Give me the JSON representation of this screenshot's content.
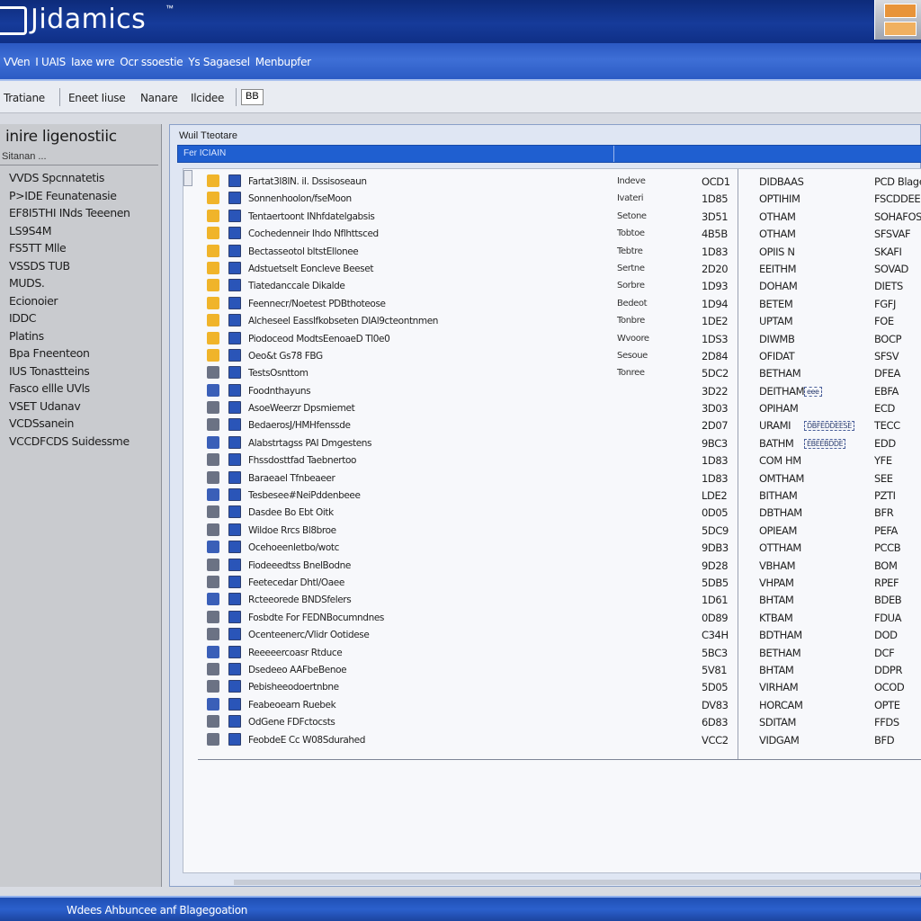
{
  "app": {
    "logo_text": "Jidamics",
    "trademark": "™"
  },
  "menu": [
    {
      "label": "VVen"
    },
    {
      "label": "I UAIS"
    },
    {
      "label": "Iaxe wre"
    },
    {
      "label": "Ocr ssoestie"
    },
    {
      "label": "Ys Sagaesel"
    },
    {
      "label": "Menbupfer"
    }
  ],
  "toolbar": {
    "items": [
      {
        "label": "Tratiane"
      },
      {
        "label": "Eneet Iiuse"
      },
      {
        "label": "Nanare"
      },
      {
        "label": "Ilcidee"
      }
    ],
    "box_label": "BB"
  },
  "left_pane": {
    "title": "inire ligenostiic",
    "subtitle": "Sitanan ...",
    "items": [
      "VVDS Spcnnatetis",
      "P>IDE Feunatenasie",
      "EF8I5THI INds Teeenen",
      "LS9S4M",
      "FS5TT Mlle",
      "VSSDS TUB",
      "MUDS.",
      "Ecionoier",
      "IDDC",
      "Platins",
      "Bpa Fneenteon",
      "IUS Tonastteins",
      "Fasco ellle UVls",
      "VSET Udanav",
      "VCDSsanein",
      "VCCDFCDS Suidessme"
    ]
  },
  "main": {
    "title": "Wuil Tteotare",
    "header_label": "Fer ICIAIN",
    "rows": [
      {
        "name": "Fartat3I8IN. iI. Dssisoseaun",
        "type": "Indeve",
        "code": "OCD1",
        "status": "DIDBAAS",
        "desc": "PCD Blagegoainen",
        "badge": ""
      },
      {
        "name": "Sonnenhoolon/fseMoon",
        "type": "Ivateri",
        "code": "1D85",
        "status": "OPTIHIM",
        "desc": "FSCDDEER",
        "badge": ""
      },
      {
        "name": "Tentaertoont INhfdatelgabsis",
        "type": "Setone",
        "code": "3D51",
        "status": "OTHAM",
        "desc": "SOHAFOS",
        "badge": ""
      },
      {
        "name": "Cochedenneir Ihdo Nflhttsced",
        "type": "Tobtoe",
        "code": "4B5B",
        "status": "OTHAM",
        "desc": "SFSVAF",
        "badge": ""
      },
      {
        "name": "Bectasseotol bltstEllonee",
        "type": "Tebtre",
        "code": "1D83",
        "status": "OPIIS N",
        "desc": "SKAFI",
        "badge": ""
      },
      {
        "name": "Adstuetselt Eoncleve Beeset",
        "type": "Sertne",
        "code": "2D20",
        "status": "EEITHM",
        "desc": "SOVAD",
        "badge": ""
      },
      {
        "name": "Tiatedanccale Dikalde",
        "type": "Sorbre",
        "code": "1D93",
        "status": "DOHAM",
        "desc": "DIETS",
        "badge": ""
      },
      {
        "name": "Feennecr/Noetest PDBthoteose",
        "type": "Bedeot",
        "code": "1D94",
        "status": "BETEM",
        "desc": "FGFJ",
        "badge": ""
      },
      {
        "name": "Alcheseel Easslfkobseten DIAl9cteontnmen",
        "type": "Tonbre",
        "code": "1DE2",
        "status": "UPTAM",
        "desc": "FOE",
        "badge": ""
      },
      {
        "name": "Piodoceod ModtsEenoaeD Tl0e0",
        "type": "Wvoore",
        "code": "1DS3",
        "status": "DIWMB",
        "desc": "BOCP",
        "badge": ""
      },
      {
        "name": "Oeo&t Gs78 FBG",
        "type": "Sesoue",
        "code": "2D84",
        "status": "OFIDAT",
        "desc": "SFSV",
        "badge": ""
      },
      {
        "name": "TestsOsnttom",
        "type": "Tonree",
        "code": "5DC2",
        "status": "BETHAM",
        "desc": "DFEA",
        "badge": ""
      },
      {
        "name": "Foodnthayuns",
        "type": "",
        "code": "3D22",
        "status": "DEITHAM",
        "desc": "EBFA",
        "badge": "eee"
      },
      {
        "name": "AsoeWeerzr Dpsmiemet",
        "type": "",
        "code": "3D03",
        "status": "OPIHAM",
        "desc": "ECD",
        "badge": ""
      },
      {
        "name": "BedaerosJ/HMHfenssde",
        "type": "",
        "code": "2D07",
        "status": "URAMI",
        "desc": "TECC",
        "badge": "DBFEDDEESE"
      },
      {
        "name": "Alabstrtagss PAI Dmgestens",
        "type": "",
        "code": "9BC3",
        "status": "BATHM",
        "desc": "EDD",
        "badge": "EBEEBDDE"
      },
      {
        "name": "Fhssdosttfad Taebnertoo",
        "type": "",
        "code": "1D83",
        "status": "COM HM",
        "desc": "YFE",
        "badge": ""
      },
      {
        "name": "Baraeael Tfnbeaeer",
        "type": "",
        "code": "1D83",
        "status": "OMTHAM",
        "desc": "SEE",
        "badge": ""
      },
      {
        "name": "Tesbesee#NeiPddenbeee",
        "type": "",
        "code": "LDE2",
        "status": "BITHAM",
        "desc": "PZTI",
        "badge": ""
      },
      {
        "name": "Dasdee Bo Ebt Oitk",
        "type": "",
        "code": "0D05",
        "status": "DBTHAM",
        "desc": "BFR",
        "badge": ""
      },
      {
        "name": "Wildoe Rrcs Bl8broe",
        "type": "",
        "code": "5DC9",
        "status": "OPIEAM",
        "desc": "PEFA",
        "badge": ""
      },
      {
        "name": "Ocehoeenletbo/wotc",
        "type": "",
        "code": "9DB3",
        "status": "OTTHAM",
        "desc": "PCCB",
        "badge": ""
      },
      {
        "name": "Fiodeeedtss BnelBodne",
        "type": "",
        "code": "9D28",
        "status": "VBHAM",
        "desc": "BOM",
        "badge": ""
      },
      {
        "name": "Feetecedar Dhtl/Oaee",
        "type": "",
        "code": "5DB5",
        "status": "VHPAM",
        "desc": "RPEF",
        "badge": ""
      },
      {
        "name": "Rcteeorede BNDSfelers",
        "type": "",
        "code": "1D61",
        "status": "BHTAM",
        "desc": "BDEB",
        "badge": ""
      },
      {
        "name": "Fosbdte For FEDNBocumndnes",
        "type": "",
        "code": "0D89",
        "status": "KTBAM",
        "desc": "FDUA",
        "badge": ""
      },
      {
        "name": "Ocenteenerc/Vlidr Ootidese",
        "type": "",
        "code": "C34H",
        "status": "BDTHAM",
        "desc": "DOD",
        "badge": ""
      },
      {
        "name": "Reeeeercoasr Rtduce",
        "type": "",
        "code": "5BC3",
        "status": "BETHAM",
        "desc": "DCF",
        "badge": ""
      },
      {
        "name": "Dsedeeo AAFbeBenoe",
        "type": "",
        "code": "5V81",
        "status": "BHTAM",
        "desc": "DDPR",
        "badge": ""
      },
      {
        "name": "Pebisheeodoertnbne",
        "type": "",
        "code": "5D05",
        "status": "VIRHAM",
        "desc": "OCOD",
        "badge": ""
      },
      {
        "name": "Feabeoearn Ruebek",
        "type": "",
        "code": "DV83",
        "status": "HORCAM",
        "desc": "OPTE",
        "badge": ""
      },
      {
        "name": "OdGene FDFctocsts",
        "type": "",
        "code": "6D83",
        "status": "SDITAM",
        "desc": "FFDS",
        "badge": ""
      },
      {
        "name": "FeobdeE Cc W08Sdurahed",
        "type": "",
        "code": "VCC2",
        "status": "VIDGAM",
        "desc": "BFD",
        "badge": ""
      }
    ]
  },
  "status_bar": {
    "text": "Wdees Ahbuncee anf Blagegoation"
  },
  "colors": {
    "titlebar": "#163b9a",
    "menustrip": "#3e6fd6",
    "accent": "#1f5fd0",
    "folder_icon": "#f0b42a",
    "module_icon": "#2a55b8"
  }
}
